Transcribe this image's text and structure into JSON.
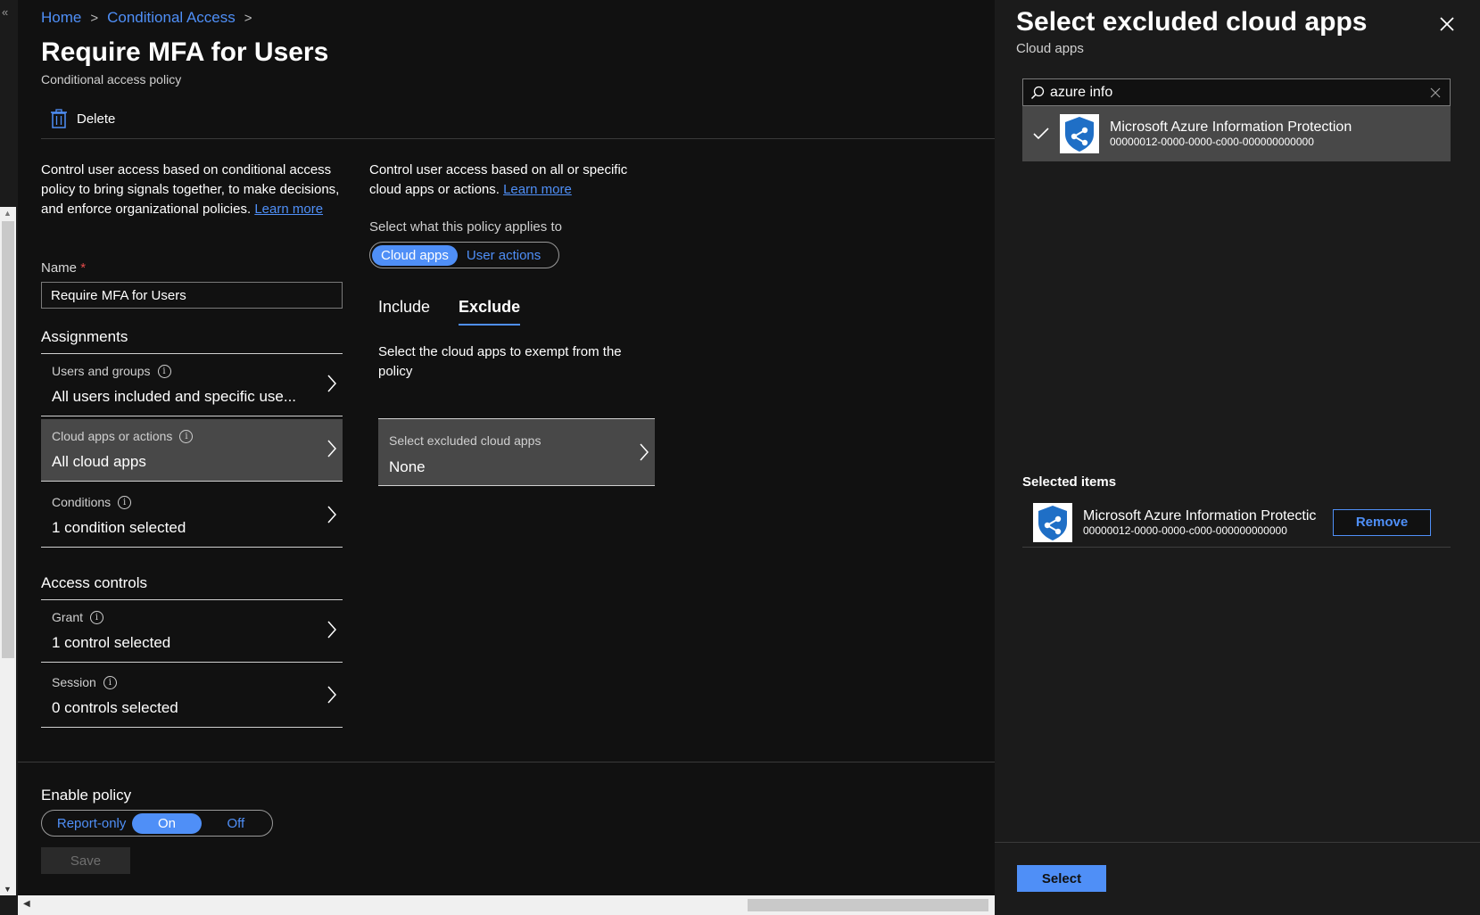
{
  "breadcrumb": {
    "home": "Home",
    "conditional_access": "Conditional Access",
    "sep": ">"
  },
  "page": {
    "title": "Require MFA for Users",
    "subtitle": "Conditional access policy"
  },
  "toolbar": {
    "delete_label": "Delete"
  },
  "intro": {
    "text": "Control user access based on conditional access policy to bring signals together, to make decisions, and enforce organizational policies.",
    "learn_more": "Learn more"
  },
  "name_field": {
    "label": "Name",
    "required_mark": "*",
    "value": "Require MFA for Users"
  },
  "assignments": {
    "heading": "Assignments",
    "items": [
      {
        "label": "Users and groups",
        "value": "All users included and specific use..."
      },
      {
        "label": "Cloud apps or actions",
        "value": "All cloud apps"
      },
      {
        "label": "Conditions",
        "value": "1 condition selected"
      }
    ]
  },
  "access_controls": {
    "heading": "Access controls",
    "items": [
      {
        "label": "Grant",
        "value": "1 control selected"
      },
      {
        "label": "Session",
        "value": "0 controls selected"
      }
    ]
  },
  "cloud_apps_pane": {
    "intro": "Control user access based on all or specific cloud apps or actions.",
    "learn_more": "Learn more",
    "applies_label": "Select what this policy applies to",
    "toggle": {
      "cloud_apps": "Cloud apps",
      "user_actions": "User actions",
      "selected": "Cloud apps"
    },
    "tabs": {
      "include": "Include",
      "exclude": "Exclude",
      "selected": "Exclude"
    },
    "exempt_desc": "Select the cloud apps to exempt from the policy",
    "excluded_card": {
      "label": "Select excluded cloud apps",
      "value": "None"
    }
  },
  "enable_policy": {
    "label": "Enable policy",
    "options": {
      "report_only": "Report-only",
      "on": "On",
      "off": "Off"
    },
    "selected": "On",
    "save_label": "Save"
  },
  "panel": {
    "title": "Select excluded cloud apps",
    "subtitle": "Cloud apps",
    "search": {
      "value": "azure info"
    },
    "results": [
      {
        "name": "Microsoft Azure Information Protection",
        "id": "00000012-0000-0000-c000-000000000000",
        "checked": true
      }
    ],
    "selected_items_label": "Selected items",
    "selected_items": [
      {
        "name": "Microsoft Azure Information Protectic",
        "id": "00000012-0000-0000-c000-000000000000"
      }
    ],
    "remove_label": "Remove",
    "select_label": "Select"
  },
  "colors": {
    "accent": "#4f8ff7",
    "background": "#111111",
    "panel_background": "#1b1b1b",
    "active_card": "#484848",
    "app_logo_blue": "#1f6fc6"
  },
  "icons": {
    "delete": "trash-icon",
    "info": "info-icon",
    "chevron": "chevron-right-icon",
    "close": "close-icon",
    "search": "search-icon",
    "clear": "clear-icon",
    "check": "checkmark-icon",
    "app": "azure-information-protection-logo"
  }
}
